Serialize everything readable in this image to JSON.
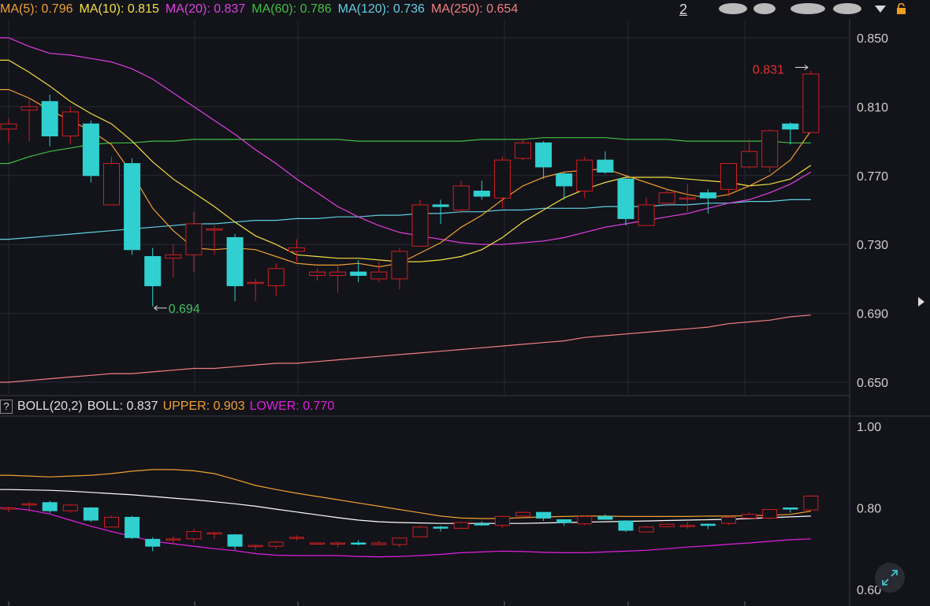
{
  "indicators": {
    "ma": [
      {
        "label": "MA(5): 0.796",
        "color": "#f0a030"
      },
      {
        "label": "MA(10): 0.815",
        "color": "#f0e040"
      },
      {
        "label": "MA(20): 0.837",
        "color": "#e040e0"
      },
      {
        "label": "MA(60): 0.786",
        "color": "#40c040"
      },
      {
        "label": "MA(120): 0.736",
        "color": "#60d0e0"
      },
      {
        "label": "MA(250): 0.654",
        "color": "#f08080"
      }
    ],
    "page_number": "2",
    "boll": {
      "help": "?",
      "name": "BOLL(20,2)",
      "boll": "BOLL: 0.837",
      "upper": "UPPER: 0.903",
      "lower": "LOWER: 0.770"
    }
  },
  "colors": {
    "up": "#d02020",
    "down": "#30d0d0",
    "grid": "#2a2a35",
    "bg": "#13131a",
    "ma5": "#f0a030",
    "ma10": "#f0e040",
    "ma20": "#e040e0",
    "ma60": "#40c040",
    "ma120": "#60d0e0",
    "ma250": "#f08080",
    "boll_mid": "#ffffff",
    "boll_upper": "#f0a030",
    "boll_lower": "#e020e0"
  },
  "chart_data": [
    {
      "type": "candlestick",
      "yticks": [
        "0.850",
        "0.810",
        "0.770",
        "0.730",
        "0.690",
        "0.650"
      ],
      "ylim": [
        0.645,
        0.853
      ],
      "annotations": [
        {
          "text": "0.831",
          "color": "#e03030"
        },
        {
          "text": "0.694",
          "color": "#40c060"
        }
      ],
      "candles": [
        {
          "o": 0.797,
          "h": 0.803,
          "l": 0.789,
          "c": 0.8
        },
        {
          "o": 0.808,
          "h": 0.815,
          "l": 0.79,
          "c": 0.81
        },
        {
          "o": 0.813,
          "h": 0.817,
          "l": 0.787,
          "c": 0.793
        },
        {
          "o": 0.793,
          "h": 0.81,
          "l": 0.788,
          "c": 0.807
        },
        {
          "o": 0.8,
          "h": 0.802,
          "l": 0.766,
          "c": 0.77
        },
        {
          "o": 0.753,
          "h": 0.781,
          "l": 0.753,
          "c": 0.777
        },
        {
          "o": 0.777,
          "h": 0.78,
          "l": 0.724,
          "c": 0.727
        },
        {
          "o": 0.723,
          "h": 0.728,
          "l": 0.694,
          "c": 0.706
        },
        {
          "o": 0.722,
          "h": 0.73,
          "l": 0.711,
          "c": 0.724
        },
        {
          "o": 0.724,
          "h": 0.749,
          "l": 0.714,
          "c": 0.742
        },
        {
          "o": 0.739,
          "h": 0.741,
          "l": 0.724,
          "c": 0.739
        },
        {
          "o": 0.734,
          "h": 0.736,
          "l": 0.697,
          "c": 0.706
        },
        {
          "o": 0.708,
          "h": 0.71,
          "l": 0.697,
          "c": 0.708
        },
        {
          "o": 0.706,
          "h": 0.719,
          "l": 0.7,
          "c": 0.716
        },
        {
          "o": 0.726,
          "h": 0.733,
          "l": 0.72,
          "c": 0.728
        },
        {
          "o": 0.712,
          "h": 0.716,
          "l": 0.709,
          "c": 0.714
        },
        {
          "o": 0.712,
          "h": 0.718,
          "l": 0.702,
          "c": 0.714
        },
        {
          "o": 0.714,
          "h": 0.721,
          "l": 0.708,
          "c": 0.712
        },
        {
          "o": 0.71,
          "h": 0.72,
          "l": 0.708,
          "c": 0.714
        },
        {
          "o": 0.71,
          "h": 0.728,
          "l": 0.704,
          "c": 0.726
        },
        {
          "o": 0.729,
          "h": 0.756,
          "l": 0.729,
          "c": 0.753
        },
        {
          "o": 0.753,
          "h": 0.756,
          "l": 0.742,
          "c": 0.752
        },
        {
          "o": 0.75,
          "h": 0.767,
          "l": 0.748,
          "c": 0.764
        },
        {
          "o": 0.761,
          "h": 0.767,
          "l": 0.756,
          "c": 0.758
        },
        {
          "o": 0.757,
          "h": 0.781,
          "l": 0.751,
          "c": 0.779
        },
        {
          "o": 0.78,
          "h": 0.791,
          "l": 0.779,
          "c": 0.789
        },
        {
          "o": 0.789,
          "h": 0.79,
          "l": 0.768,
          "c": 0.775
        },
        {
          "o": 0.771,
          "h": 0.772,
          "l": 0.756,
          "c": 0.764
        },
        {
          "o": 0.761,
          "h": 0.781,
          "l": 0.757,
          "c": 0.779
        },
        {
          "o": 0.779,
          "h": 0.784,
          "l": 0.771,
          "c": 0.772
        },
        {
          "o": 0.768,
          "h": 0.77,
          "l": 0.741,
          "c": 0.745
        },
        {
          "o": 0.741,
          "h": 0.757,
          "l": 0.741,
          "c": 0.753
        },
        {
          "o": 0.754,
          "h": 0.762,
          "l": 0.752,
          "c": 0.76
        },
        {
          "o": 0.757,
          "h": 0.765,
          "l": 0.749,
          "c": 0.757
        },
        {
          "o": 0.76,
          "h": 0.762,
          "l": 0.748,
          "c": 0.757
        },
        {
          "o": 0.762,
          "h": 0.775,
          "l": 0.758,
          "c": 0.777
        },
        {
          "o": 0.775,
          "h": 0.791,
          "l": 0.774,
          "c": 0.784
        },
        {
          "o": 0.775,
          "h": 0.797,
          "l": 0.772,
          "c": 0.796
        },
        {
          "o": 0.8,
          "h": 0.801,
          "l": 0.788,
          "c": 0.797
        },
        {
          "o": 0.795,
          "h": 0.831,
          "l": 0.795,
          "c": 0.829
        }
      ],
      "ma5": [
        0.82,
        0.815,
        0.808,
        0.802,
        0.796,
        0.788,
        0.771,
        0.751,
        0.738,
        0.728,
        0.727,
        0.728,
        0.727,
        0.723,
        0.719,
        0.718,
        0.718,
        0.719,
        0.717,
        0.719,
        0.725,
        0.731,
        0.74,
        0.747,
        0.756,
        0.764,
        0.769,
        0.772,
        0.773,
        0.774,
        0.77,
        0.766,
        0.762,
        0.759,
        0.757,
        0.759,
        0.764,
        0.77,
        0.779,
        0.796
      ],
      "ma10": [
        0.837,
        0.83,
        0.822,
        0.813,
        0.806,
        0.8,
        0.79,
        0.778,
        0.768,
        0.76,
        0.752,
        0.743,
        0.735,
        0.73,
        0.724,
        0.723,
        0.722,
        0.722,
        0.721,
        0.72,
        0.72,
        0.721,
        0.723,
        0.727,
        0.734,
        0.743,
        0.75,
        0.757,
        0.762,
        0.766,
        0.769,
        0.769,
        0.769,
        0.768,
        0.767,
        0.766,
        0.764,
        0.765,
        0.768,
        0.776
      ],
      "ma20": [
        0.85,
        0.845,
        0.841,
        0.84,
        0.838,
        0.836,
        0.832,
        0.826,
        0.818,
        0.81,
        0.802,
        0.794,
        0.785,
        0.777,
        0.768,
        0.76,
        0.752,
        0.746,
        0.741,
        0.737,
        0.735,
        0.733,
        0.731,
        0.73,
        0.73,
        0.731,
        0.732,
        0.734,
        0.737,
        0.74,
        0.742,
        0.744,
        0.746,
        0.748,
        0.751,
        0.754,
        0.756,
        0.76,
        0.765,
        0.772
      ],
      "ma60": [
        0.777,
        0.781,
        0.784,
        0.786,
        0.788,
        0.789,
        0.789,
        0.79,
        0.79,
        0.791,
        0.791,
        0.791,
        0.791,
        0.791,
        0.791,
        0.791,
        0.791,
        0.79,
        0.79,
        0.79,
        0.79,
        0.79,
        0.79,
        0.791,
        0.791,
        0.791,
        0.792,
        0.792,
        0.792,
        0.792,
        0.791,
        0.791,
        0.791,
        0.79,
        0.79,
        0.79,
        0.79,
        0.79,
        0.789,
        0.789
      ],
      "ma120": [
        0.733,
        0.734,
        0.735,
        0.736,
        0.737,
        0.738,
        0.739,
        0.74,
        0.741,
        0.742,
        0.742,
        0.743,
        0.744,
        0.744,
        0.745,
        0.745,
        0.746,
        0.746,
        0.747,
        0.747,
        0.748,
        0.748,
        0.749,
        0.749,
        0.75,
        0.75,
        0.751,
        0.751,
        0.751,
        0.752,
        0.752,
        0.752,
        0.753,
        0.753,
        0.754,
        0.754,
        0.755,
        0.755,
        0.756,
        0.756
      ],
      "ma250": [
        0.65,
        0.651,
        0.652,
        0.653,
        0.654,
        0.655,
        0.655,
        0.656,
        0.657,
        0.658,
        0.658,
        0.659,
        0.66,
        0.661,
        0.661,
        0.662,
        0.663,
        0.664,
        0.665,
        0.666,
        0.667,
        0.668,
        0.669,
        0.67,
        0.671,
        0.672,
        0.673,
        0.674,
        0.676,
        0.677,
        0.678,
        0.679,
        0.68,
        0.681,
        0.682,
        0.684,
        0.685,
        0.686,
        0.688,
        0.689
      ]
    },
    {
      "type": "boll",
      "yticks": [
        "1.00",
        "0.80",
        "0.60"
      ],
      "ylim": [
        0.6,
        1.0
      ],
      "upper": [
        0.88,
        0.878,
        0.876,
        0.878,
        0.88,
        0.884,
        0.89,
        0.894,
        0.894,
        0.891,
        0.884,
        0.87,
        0.855,
        0.845,
        0.836,
        0.828,
        0.82,
        0.812,
        0.804,
        0.796,
        0.788,
        0.78,
        0.775,
        0.774,
        0.774,
        0.776,
        0.778,
        0.779,
        0.78,
        0.78,
        0.779,
        0.779,
        0.779,
        0.779,
        0.78,
        0.78,
        0.781,
        0.782,
        0.784,
        0.792
      ],
      "mid": [
        0.845,
        0.844,
        0.843,
        0.841,
        0.838,
        0.835,
        0.832,
        0.828,
        0.824,
        0.82,
        0.815,
        0.81,
        0.804,
        0.797,
        0.79,
        0.783,
        0.776,
        0.77,
        0.766,
        0.764,
        0.763,
        0.762,
        0.762,
        0.762,
        0.762,
        0.762,
        0.763,
        0.764,
        0.765,
        0.766,
        0.767,
        0.768,
        0.769,
        0.77,
        0.771,
        0.772,
        0.774,
        0.776,
        0.778,
        0.78
      ],
      "lower": [
        0.8,
        0.795,
        0.785,
        0.77,
        0.755,
        0.742,
        0.73,
        0.718,
        0.712,
        0.706,
        0.7,
        0.695,
        0.688,
        0.684,
        0.683,
        0.683,
        0.683,
        0.681,
        0.68,
        0.681,
        0.683,
        0.686,
        0.69,
        0.692,
        0.694,
        0.693,
        0.691,
        0.69,
        0.69,
        0.692,
        0.694,
        0.696,
        0.7,
        0.704,
        0.707,
        0.711,
        0.714,
        0.718,
        0.722,
        0.724
      ],
      "candle_scale": 1.0
    }
  ]
}
